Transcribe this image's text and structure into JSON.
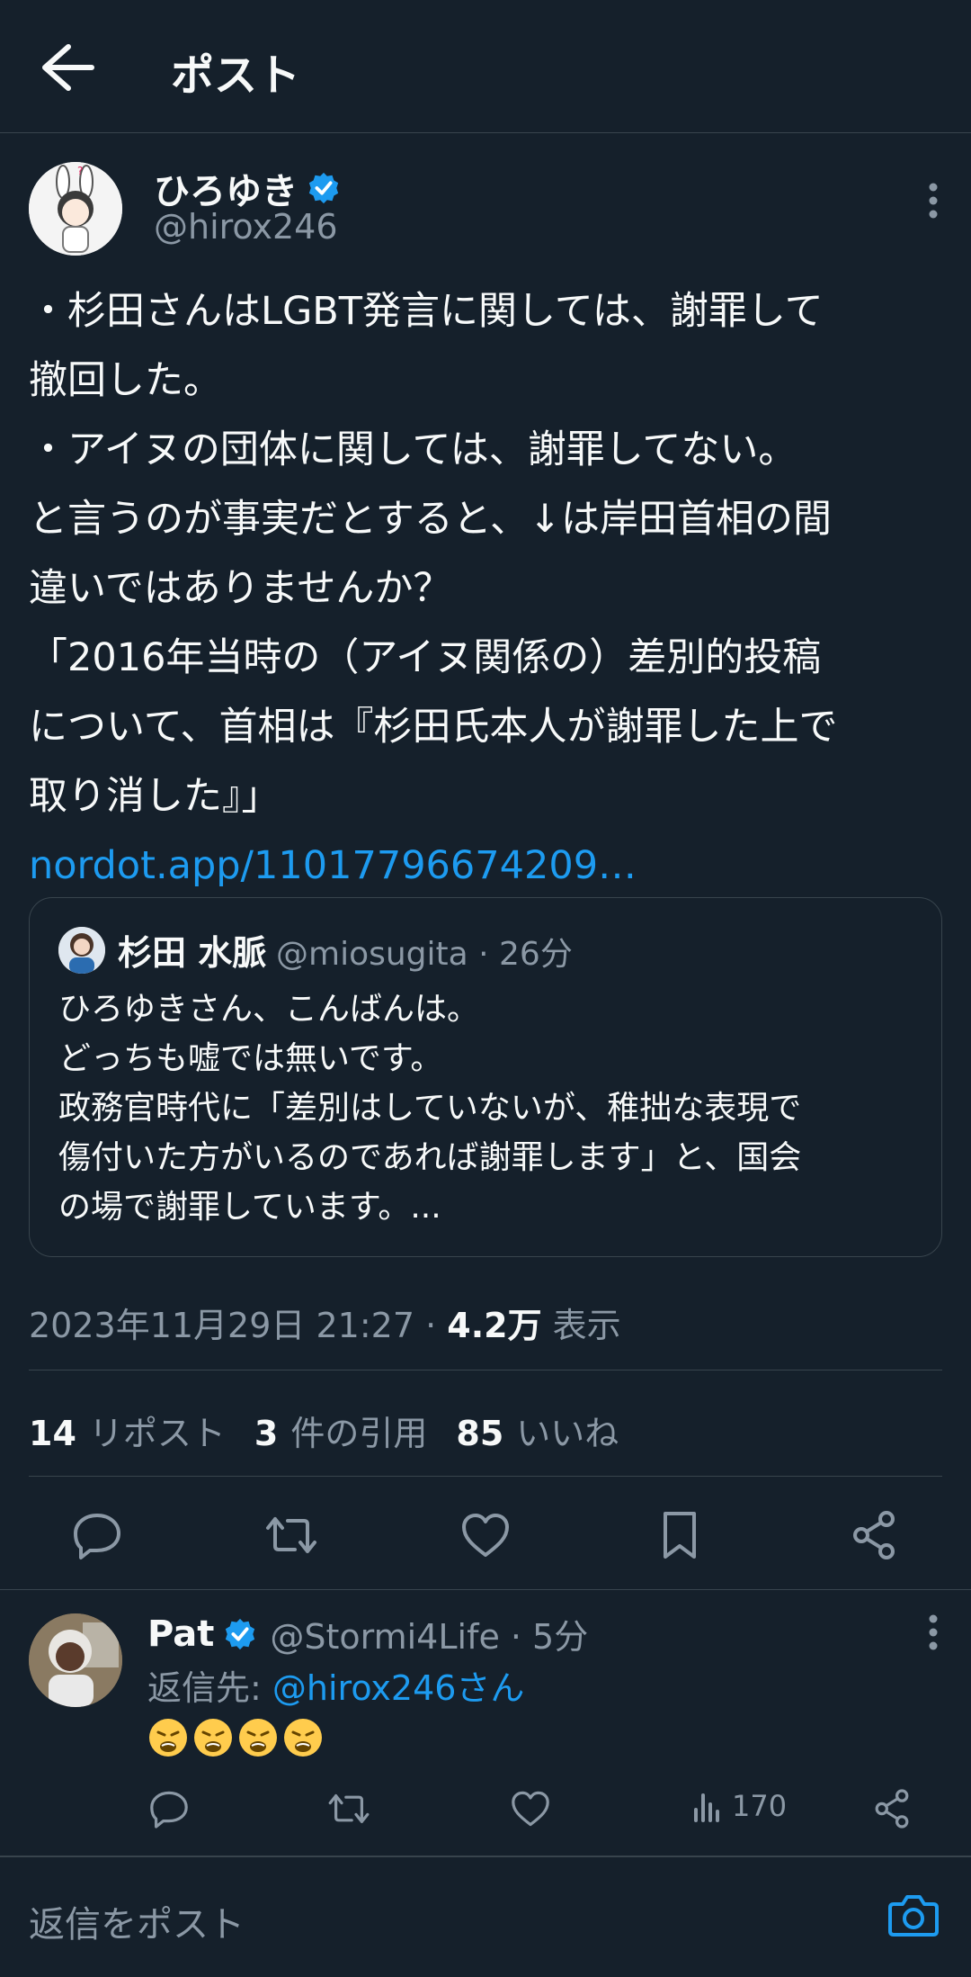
{
  "header": {
    "title": "ポスト"
  },
  "post": {
    "author_name": "ひろゆき",
    "author_handle": "@hirox246",
    "lines": [
      "・杉田さんはLGBT発言に関しては、謝罪して",
      "撤回した。",
      "・アイヌの団体に関しては、謝罪してない。",
      "と言うのが事実だとすると、↓は岸田首相の間",
      "違いではありませんか？",
      "「2016年当時の（アイヌ関係の）差別的投稿",
      "について、首相は『杉田氏本人が謝罪した上で",
      "取り消した』」"
    ],
    "link": "nordot.app/11017796674209…",
    "timestamp": "2023年11月29日 21:27 · ",
    "views_count": "4.2万",
    "views_label": " 表示"
  },
  "quote": {
    "name": "杉田 水脈",
    "meta": "@miosugita · 26分",
    "lines": [
      "ひろゆきさん、こんばんは。",
      "どっちも嘘では無いです。",
      "政務官時代に「差別はしていないが、稚拙な表現で",
      "傷付いた方がいるのであれば謝罪します」と、国会",
      "の場で謝罪しています。..."
    ]
  },
  "stats": {
    "reposts_count": "14",
    "reposts_label": "リポスト",
    "quotes_count": "3",
    "quotes_label": "件の引用",
    "likes_count": "85",
    "likes_label": "いいね"
  },
  "reply": {
    "name": "Pat",
    "meta": "@Stormi4Life · 5分",
    "reply_prefix": "返信先: ",
    "reply_mention": "@hirox246さん",
    "emojis": [
      "weary-face",
      "weary-face",
      "weary-face",
      "weary-face"
    ],
    "views": "170"
  },
  "compose": {
    "placeholder": "返信をポスト"
  },
  "colors": {
    "background": "#15202b",
    "accent": "#1d9bf0",
    "muted": "#8b98a5",
    "border": "#38444d"
  }
}
